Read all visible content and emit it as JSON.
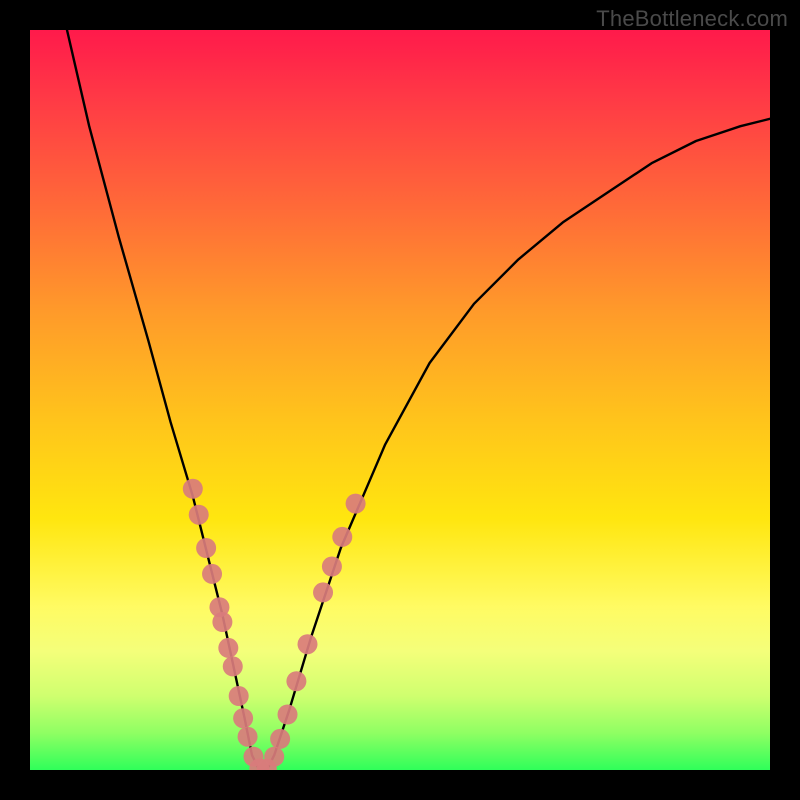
{
  "watermark": "TheBottleneck.com",
  "chart_data": {
    "type": "line",
    "title": "",
    "xlabel": "",
    "ylabel": "",
    "xlim": [
      0,
      100
    ],
    "ylim": [
      0,
      100
    ],
    "gradient_scale": [
      "#ff1a4b",
      "#ff9a2a",
      "#ffe60f",
      "#2fff5a"
    ],
    "series": [
      {
        "name": "black-curve",
        "x": [
          5,
          8,
          12,
          16,
          19,
          22,
          24,
          26,
          27.5,
          29,
          30,
          31,
          32,
          33,
          35,
          38,
          42,
          48,
          54,
          60,
          66,
          72,
          78,
          84,
          90,
          96,
          100
        ],
        "y": [
          100,
          87,
          72,
          58,
          47,
          37,
          29,
          21,
          14,
          7,
          2,
          0,
          0,
          2,
          8,
          18,
          30,
          44,
          55,
          63,
          69,
          74,
          78,
          82,
          85,
          87,
          88
        ]
      }
    ],
    "highlight_points": {
      "name": "salmon-dots",
      "color": "#d97c7c",
      "radius_px": 10,
      "points": [
        {
          "x": 22.0,
          "y": 38.0
        },
        {
          "x": 22.8,
          "y": 34.5
        },
        {
          "x": 23.8,
          "y": 30.0
        },
        {
          "x": 24.6,
          "y": 26.5
        },
        {
          "x": 25.6,
          "y": 22.0
        },
        {
          "x": 26.0,
          "y": 20.0
        },
        {
          "x": 26.8,
          "y": 16.5
        },
        {
          "x": 27.4,
          "y": 14.0
        },
        {
          "x": 28.2,
          "y": 10.0
        },
        {
          "x": 28.8,
          "y": 7.0
        },
        {
          "x": 29.4,
          "y": 4.5
        },
        {
          "x": 30.2,
          "y": 1.8
        },
        {
          "x": 31.0,
          "y": 0.2
        },
        {
          "x": 32.0,
          "y": 0.2
        },
        {
          "x": 33.0,
          "y": 1.8
        },
        {
          "x": 33.8,
          "y": 4.2
        },
        {
          "x": 34.8,
          "y": 7.5
        },
        {
          "x": 36.0,
          "y": 12.0
        },
        {
          "x": 37.5,
          "y": 17.0
        },
        {
          "x": 39.6,
          "y": 24.0
        },
        {
          "x": 40.8,
          "y": 27.5
        },
        {
          "x": 42.2,
          "y": 31.5
        },
        {
          "x": 44.0,
          "y": 36.0
        }
      ]
    }
  }
}
